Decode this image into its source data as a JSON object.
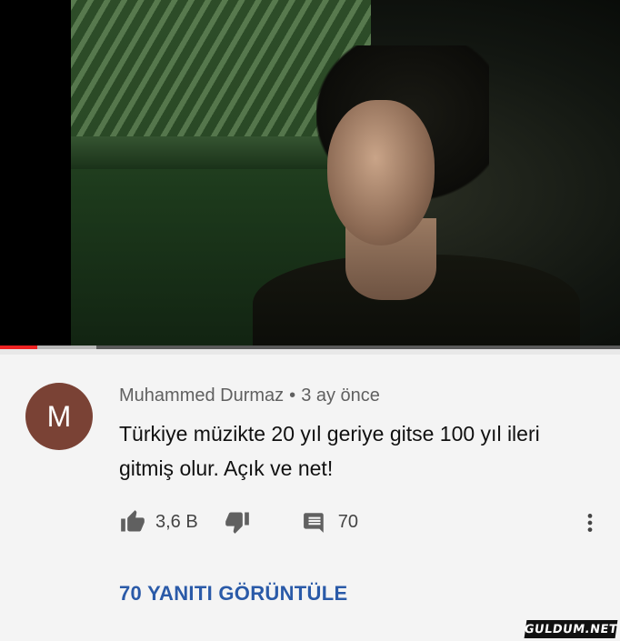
{
  "video": {
    "progress_played": 0.06,
    "progress_buffered": 0.155
  },
  "comment": {
    "avatar_letter": "M",
    "avatar_color": "#7a4235",
    "author": "Muhammed Durmaz",
    "separator": "•",
    "time": "3 ay önce",
    "text": "Türkiye müzikte 20 yıl geriye gitse 100 yıl ileri gitmiş olur. Açık ve net!",
    "like_count": "3,6 B",
    "reply_count": "70",
    "view_replies_label": "70 YANITI GÖRÜNTÜLE"
  },
  "icons": {
    "like": "thumbs-up-icon",
    "dislike": "thumbs-down-icon",
    "reply": "comment-icon",
    "more": "more-vertical-icon"
  },
  "colors": {
    "link": "#2a5aa8",
    "progress_played": "#ee2222"
  },
  "watermark": "GULDUM.NET"
}
